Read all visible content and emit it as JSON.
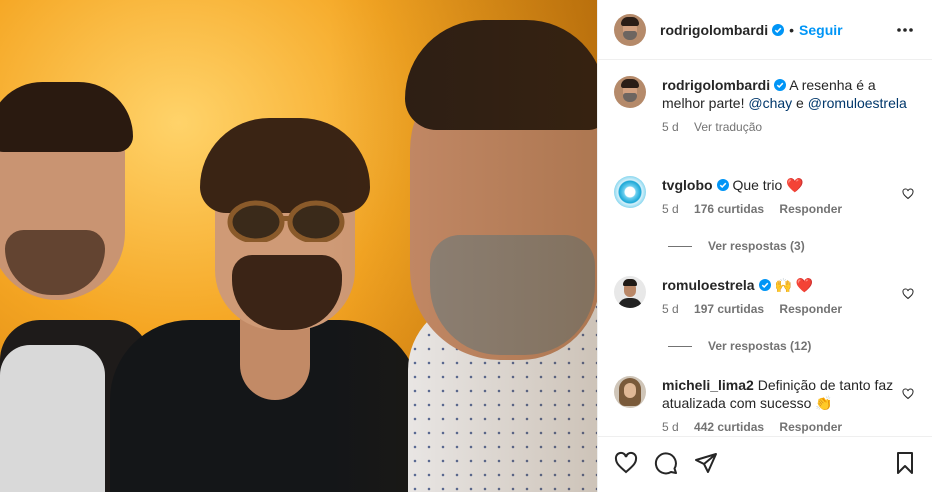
{
  "post": {
    "username": "rodrigolombardi",
    "follow_label": "Seguir",
    "separator": "•"
  },
  "caption": {
    "username": "rodrigolombardi",
    "text_before": "A resenha é a melhor parte! ",
    "mention1": "@chay",
    "text_mid": " e ",
    "mention2": "@romuloestrela",
    "time": "5 d",
    "translate_label": "Ver tradução"
  },
  "comments": [
    {
      "username": "tvglobo",
      "text": "Que trio",
      "emoji": "❤️",
      "time": "5 d",
      "likes": "176 curtidas",
      "reply_label": "Responder",
      "view_replies": "Ver respostas (3)"
    },
    {
      "username": "romuloestrela",
      "text": "",
      "emoji": "🙌 ❤️",
      "time": "5 d",
      "likes": "197 curtidas",
      "reply_label": "Responder",
      "view_replies": "Ver respostas (12)"
    },
    {
      "username": "micheli_lima2",
      "text": "Definição de tanto faz atualizada com sucesso",
      "emoji": "👏",
      "time": "5 d",
      "likes": "442 curtidas",
      "reply_label": "Responder"
    }
  ],
  "icons": {
    "verified": "verified-badge-icon",
    "more": "more-horizontal-icon",
    "like": "heart-icon",
    "comment": "comment-icon",
    "share": "paper-plane-icon",
    "save": "bookmark-icon"
  },
  "colors": {
    "accent": "#0095f6",
    "mention": "#00376b",
    "heart": "#ed1c24",
    "muted": "#737373"
  }
}
